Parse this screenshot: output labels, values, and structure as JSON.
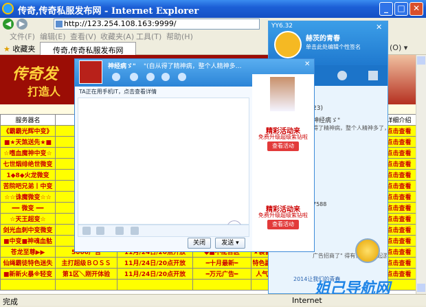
{
  "window": {
    "title": "传奇,传奇私服发布网 - Internet Explorer"
  },
  "address": {
    "url": "http://123.254.108.163:9999/"
  },
  "menu": [
    "文件(F)",
    "编辑(E)",
    "查看(V)",
    "收藏夹(A)",
    "工具(T)",
    "帮助(H)"
  ],
  "favorites": {
    "label": "收藏夹",
    "tab_title": "传奇,传奇私服发布网"
  },
  "page": {
    "logo": "传奇发",
    "logo_sub": "打造人",
    "subtitle": "传奇私服",
    "headers": [
      "服务器名",
      "",
      "",
      "",
      "",
      "",
      "详细介绍"
    ],
    "rows": [
      [
        "《霸霸光辉中变》",
        "（ 大",
        "",
        "",
        "",
        "",
        "点击查看"
      ],
      [
        "■★天煞送先★■",
        "1 0 0",
        "",
        "",
        "",
        "",
        "点击查看"
      ],
      [
        "☆嗜血魔神中变☆",
        "| 绝对",
        "",
        "",
        "",
        "",
        "点击查看"
      ],
      [
        "七世烟绯绝世微变",
        "绝对自",
        "",
        "",
        "",
        "",
        "点击查看"
      ],
      [
        "1◆8◆火龙微变",
        "火爆一",
        "",
        "",
        "",
        "",
        "点击查看"
      ],
      [
        "苦院吧兄弟丨中变",
        "1 1 月",
        "",
        "",
        "",
        "",
        "点击查看"
      ],
      [
        "☆☆诛魔微变☆☆",
        "1 1 月",
        "",
        "",
        "",
        "",
        "点击查看"
      ],
      [
        "━━ 微变 ━━",
        "━━",
        "",
        "",
        "",
        "",
        "点击查看"
      ],
      [
        "☆天王超变☆",
        "■打",
        "",
        "",
        "",
        "",
        "点击查看"
      ],
      [
        "剑光血刺中变微变",
        "超多",
        "",
        "",
        "",
        "",
        "点击查看"
      ],
      [
        "■中变■神魂血骷",
        "绝对1",
        "",
        "",
        "",
        "",
        "点击查看"
      ],
      [
        "苍龙至尊▶▶",
        "5000广告",
        "11月/24日/20点开放",
        "◆■不乱合区",
        "★装备全暴★上线就",
        "",
        "点击查看"
      ],
      [
        "仙绳霸徒特色迷失",
        "主打超级ＢＯＳＳ",
        "11月/24日/20点开放",
        "━十月最新━",
        "特色副本十主打超级",
        "",
        "点击查看"
      ],
      [
        "■新新火暴※轻变",
        "第1区＼刚开体验",
        "11月/24日/20点开放",
        "━万元广告━",
        "人气高■装备掉打",
        "",
        "点击查看"
      ],
      [
        "",
        "",
        "",
        "",
        "",
        "",
        ""
      ]
    ]
  },
  "qq": {
    "version": "YY6.32",
    "nickname": "赫茨的青春",
    "status": "单击此处编辑个性签名",
    "date": "23)",
    "msg": "神经病ゞ\" ",
    "msg2": "得了精神病，整个人精神多了，呦呦",
    "num": "7588",
    "bottom": "广告招商了\" 得有位有趣一起游戏又者",
    "footer": "2014让我们的青春"
  },
  "chat": {
    "name": "神经病ゞ\" ",
    "signature": "\"(自从得了精神病，整个人精神多…",
    "notice": "TA正在用手机IT，点击查看详情",
    "close": "关闭",
    "send": "发送",
    "ad_title": "精彩活动来",
    "ad_sub": "免费升级超级紫钻啦",
    "ad_btn": "查看活动"
  },
  "status": {
    "left": "完成",
    "zone": "Internet"
  },
  "watermark": "姐己导航网",
  "colors": {
    "title": "#1c5fd6",
    "banner": "#9b0d05",
    "cell": "#ffff00"
  }
}
